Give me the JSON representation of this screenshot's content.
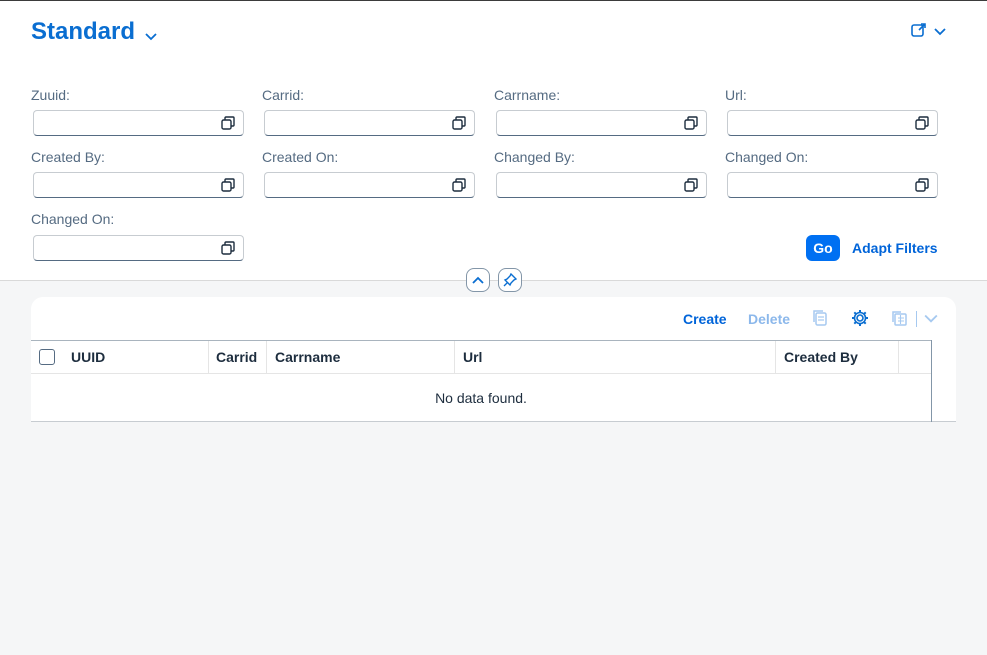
{
  "header": {
    "variant_title": "Standard",
    "icons": {
      "variant_menu": "chevron-down-icon",
      "share": "share-icon"
    }
  },
  "filters": [
    {
      "label": "Zuuid:",
      "value": "",
      "icon": "value-help-icon"
    },
    {
      "label": "Carrid:",
      "value": "",
      "icon": "value-help-icon"
    },
    {
      "label": "Carrname:",
      "value": "",
      "icon": "value-help-icon"
    },
    {
      "label": "Url:",
      "value": "",
      "icon": "value-help-icon"
    },
    {
      "label": "Created By:",
      "value": "",
      "icon": "value-help-icon"
    },
    {
      "label": "Created On:",
      "value": "",
      "icon": "value-help-icon"
    },
    {
      "label": "Changed By:",
      "value": "",
      "icon": "value-help-icon"
    },
    {
      "label": "Changed On:",
      "value": "",
      "icon": "value-help-icon"
    },
    {
      "label": "Changed On:",
      "value": "",
      "icon": "value-help-icon"
    }
  ],
  "filterbar": {
    "go_label": "Go",
    "adapt_label": "Adapt Filters"
  },
  "table": {
    "toolbar": {
      "create_label": "Create",
      "delete_label": "Delete",
      "icons": [
        "copy-icon",
        "settings-icon",
        "export-icon",
        "chevron-down-icon"
      ]
    },
    "columns": [
      "UUID",
      "Carrid",
      "Carrname",
      "Url",
      "Created By"
    ],
    "no_data_text": "No data found."
  },
  "colors": {
    "accent": "#0a6ed1",
    "button": "#0070f2",
    "link": "#0064d9",
    "disabled": "#8cb8eb"
  }
}
